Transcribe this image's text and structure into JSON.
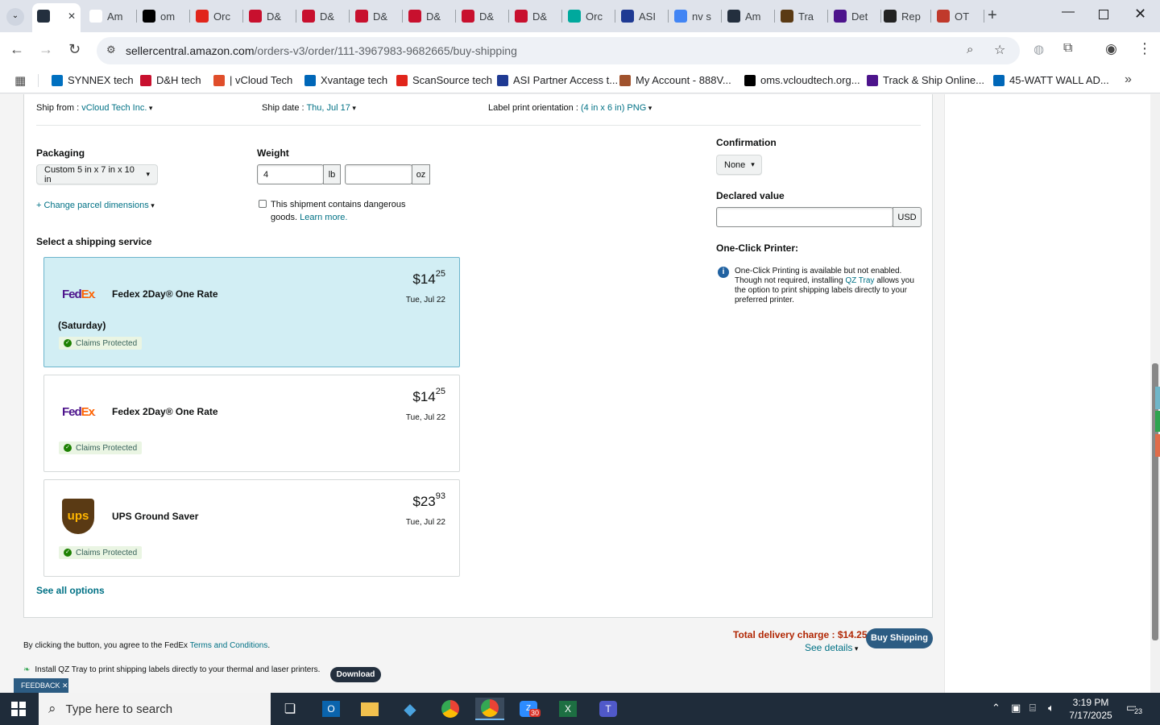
{
  "browser": {
    "tabs": [
      {
        "label": "",
        "icon": "amazon-a-icon",
        "color": "#232f3e"
      },
      {
        "label": "Am",
        "icon": "amazon-icon",
        "color": "#ffffff"
      },
      {
        "label": "om",
        "icon": "oms-icon",
        "color": "#000000"
      },
      {
        "label": "Orc",
        "icon": "scansource-icon",
        "color": "#e1251b"
      },
      {
        "label": "D&",
        "icon": "dh-icon",
        "color": "#c8102e"
      },
      {
        "label": "D&",
        "icon": "dh-icon",
        "color": "#c8102e"
      },
      {
        "label": "D&",
        "icon": "dh-icon",
        "color": "#c8102e"
      },
      {
        "label": "D&",
        "icon": "dh-icon",
        "color": "#c8102e"
      },
      {
        "label": "D&",
        "icon": "dh-icon",
        "color": "#c8102e"
      },
      {
        "label": "D&",
        "icon": "dh-icon",
        "color": "#c8102e"
      },
      {
        "label": "Orc",
        "icon": "ec-icon",
        "color": "#00a99d"
      },
      {
        "label": "ASI",
        "icon": "asi-icon",
        "color": "#1f3a93"
      },
      {
        "label": "nv s",
        "icon": "google-icon",
        "color": "#4285f4"
      },
      {
        "label": "Am",
        "icon": "amazon-a-icon",
        "color": "#232f3e"
      },
      {
        "label": "Tra",
        "icon": "ups-icon",
        "color": "#5a3a14"
      },
      {
        "label": "Det",
        "icon": "fedex-icon",
        "color": "#4d148c"
      },
      {
        "label": "Rep",
        "icon": "rep-icon",
        "color": "#222222"
      },
      {
        "label": "OT",
        "icon": "ot-icon",
        "color": "#c0392b"
      }
    ],
    "url_host": "sellercentral.amazon.com",
    "url_path": "/orders-v3/order/111-3967983-9682665/buy-shipping",
    "bookmarks": [
      {
        "label": "SYNNEX tech",
        "icon": "ec-icon",
        "color": "#0070c0"
      },
      {
        "label": "D&H tech",
        "icon": "dh-icon",
        "color": "#c8102e"
      },
      {
        "label": "| vCloud Tech",
        "icon": "vcloud-icon",
        "color": "#e04e2b"
      },
      {
        "label": "Xvantage tech",
        "icon": "xvantage-icon",
        "color": "#0067b8"
      },
      {
        "label": "ScanSource tech",
        "icon": "scansource-icon",
        "color": "#e1251b"
      },
      {
        "label": "ASI Partner Access t...",
        "icon": "asi-icon",
        "color": "#1f3a93"
      },
      {
        "label": "My Account - 888V...",
        "icon": "account-icon",
        "color": "#a0522d"
      },
      {
        "label": "oms.vcloudtech.org...",
        "icon": "oms-icon",
        "color": "#000000"
      },
      {
        "label": "Track & Ship Online...",
        "icon": "fedex-icon",
        "color": "#4d148c"
      },
      {
        "label": "45-WATT WALL AD...",
        "icon": "xvantage-icon",
        "color": "#0067b8"
      }
    ]
  },
  "form": {
    "ship_from_label": "Ship from : ",
    "ship_from_value": "vCloud Tech Inc.",
    "ship_date_label": "Ship date : ",
    "ship_date_value": "Thu, Jul 17",
    "orientation_label": "Label print orientation : ",
    "orientation_value": "(4 in x 6 in) PNG",
    "packaging_label": "Packaging",
    "packaging_value": "Custom 5 in x 7 in x 10 in",
    "weight_label": "Weight",
    "weight_lb": "4",
    "weight_lb_unit": "lb",
    "weight_oz": "",
    "weight_oz_unit": "oz",
    "change_dims": "+ Change parcel dimensions",
    "dangerous_text": "This shipment contains dangerous goods.",
    "learn_more": "Learn more.",
    "confirmation_label": "Confirmation",
    "confirmation_value": "None",
    "declared_label": "Declared value",
    "declared_value": "",
    "declared_unit": "USD",
    "oneclick_label": "One-Click Printer:",
    "oneclick_text_1": "One-Click Printing is available but not enabled. Though not required, installing ",
    "oneclick_link": "QZ Tray",
    "oneclick_text_2": " allows you the option to print shipping labels directly to your preferred printer.",
    "select_service_label": "Select a shipping service",
    "see_all": "See all options"
  },
  "services": [
    {
      "carrier": "FedEx",
      "name": "Fedex 2Day® One Rate",
      "extra": "(Saturday)",
      "price_dollars": "$14",
      "price_cents": "25",
      "date": "Tue, Jul 22",
      "claims": "Claims Protected",
      "selected": true
    },
    {
      "carrier": "FedEx",
      "name": "Fedex 2Day® One Rate",
      "extra": "",
      "price_dollars": "$14",
      "price_cents": "25",
      "date": "Tue, Jul 22",
      "claims": "Claims Protected",
      "selected": false
    },
    {
      "carrier": "UPS",
      "name": "UPS Ground Saver",
      "extra": "",
      "price_dollars": "$23",
      "price_cents": "93",
      "date": "Tue, Jul 22",
      "claims": "Claims Protected",
      "selected": false
    }
  ],
  "footer": {
    "agree_text": "By clicking the button, you agree to the FedEx ",
    "terms_link": "Terms and Conditions",
    "agree_end": ".",
    "total_label": "Total delivery charge : $14.25",
    "see_details": "See details",
    "buy_button": "Buy Shipping",
    "qz_text": "Install QZ Tray to print shipping labels directly to your thermal and laser printers.",
    "download": "Download",
    "feedback": "FEEDBACK"
  },
  "taskbar": {
    "search_placeholder": "Type here to search",
    "time": "3:19 PM",
    "date": "7/17/2025",
    "notification_count": "23",
    "zoom_badge": "30"
  },
  "colors": {
    "accent_link": "#007185",
    "selected_bg": "#d2eef4",
    "buy_button": "#2c5c83",
    "total_text": "#b12704"
  }
}
